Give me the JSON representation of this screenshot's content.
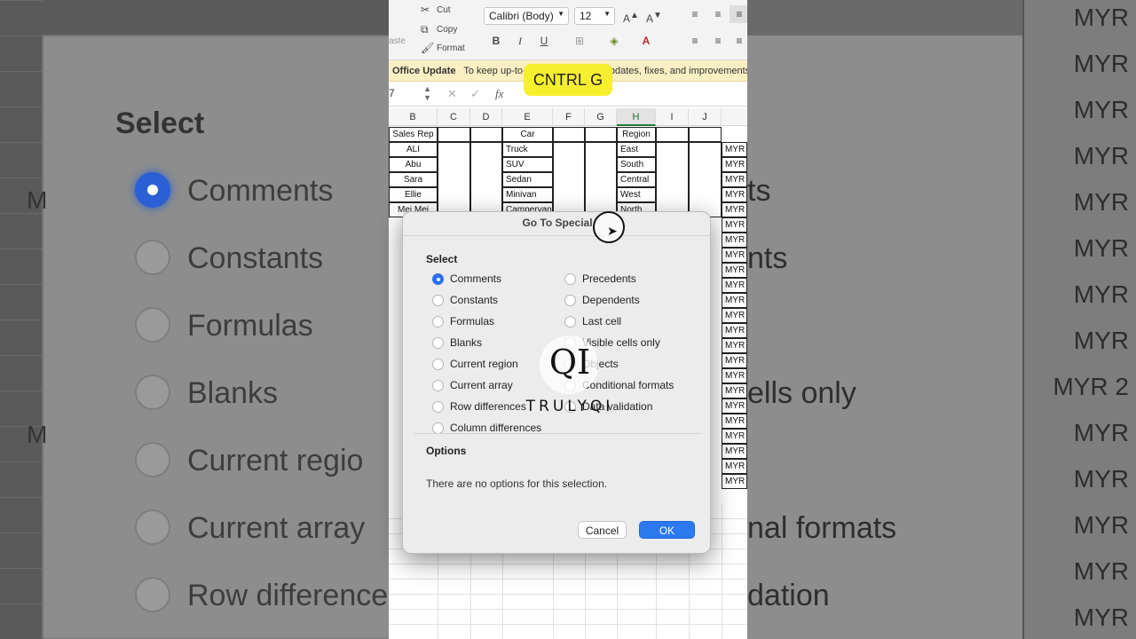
{
  "ribbon": {
    "cut": "Cut",
    "copy": "Copy",
    "format": "Format",
    "paste_partial": "aste",
    "font_name": "Calibri (Body)",
    "font_size": "12",
    "bold": "B",
    "italic": "I",
    "underline": "U"
  },
  "update_bar": {
    "title": "Office Update",
    "message": "To keep up-to-date with security updates, fixes, and improvements"
  },
  "formula_bar": {
    "cell_ref": "7",
    "fx": "fx"
  },
  "overlay_label": "CNTRL G",
  "columns": [
    "B",
    "C",
    "D",
    "E",
    "F",
    "G",
    "H",
    "I",
    "J"
  ],
  "selected_column": "H",
  "table": {
    "headers": {
      "rep": "Sales Rep",
      "car": "Car",
      "region": "Region"
    },
    "rows": [
      {
        "rep": "ALI",
        "car": "Truck",
        "region": "East"
      },
      {
        "rep": "Abu",
        "car": "SUV",
        "region": "South"
      },
      {
        "rep": "Sara",
        "car": "Sedan",
        "region": "Central"
      },
      {
        "rep": "Ellie",
        "car": "Minivan",
        "region": "West"
      },
      {
        "rep": "Mei Mei",
        "car": "Campervan",
        "region": "North"
      }
    ],
    "currency": "MYR"
  },
  "dialog": {
    "title": "Go To Special",
    "select_heading": "Select",
    "left_options": [
      "Comments",
      "Constants",
      "Formulas",
      "Blanks",
      "Current region",
      "Current array",
      "Row differences",
      "Column differences"
    ],
    "right_options": [
      "Precedents",
      "Dependents",
      "Last cell",
      "Visible cells only",
      "Objects",
      "Conditional formats",
      "Data validation"
    ],
    "selected": "Comments",
    "options_heading": "Options",
    "options_note": "There are no options for this selection.",
    "cancel": "Cancel",
    "ok": "OK"
  },
  "background_left": {
    "title": "Select",
    "items": [
      "Comments",
      "Constants",
      "Formulas",
      "Blanks",
      "Current regio",
      "Current array",
      "Row difference"
    ],
    "row_marker": "M"
  },
  "background_right": {
    "items": [
      "ts",
      "nts",
      "ells only",
      "nal formats",
      "dation"
    ],
    "cells": [
      "MYR",
      "MYR",
      "MYR",
      "MYR",
      "MYR",
      "MYR",
      "MYR",
      "MYR",
      "MYR 2",
      "MYR",
      "MYR",
      "MYR",
      "MYR",
      "MYR"
    ]
  },
  "watermark": {
    "logo": "QI",
    "brand": "TRULYQI"
  }
}
